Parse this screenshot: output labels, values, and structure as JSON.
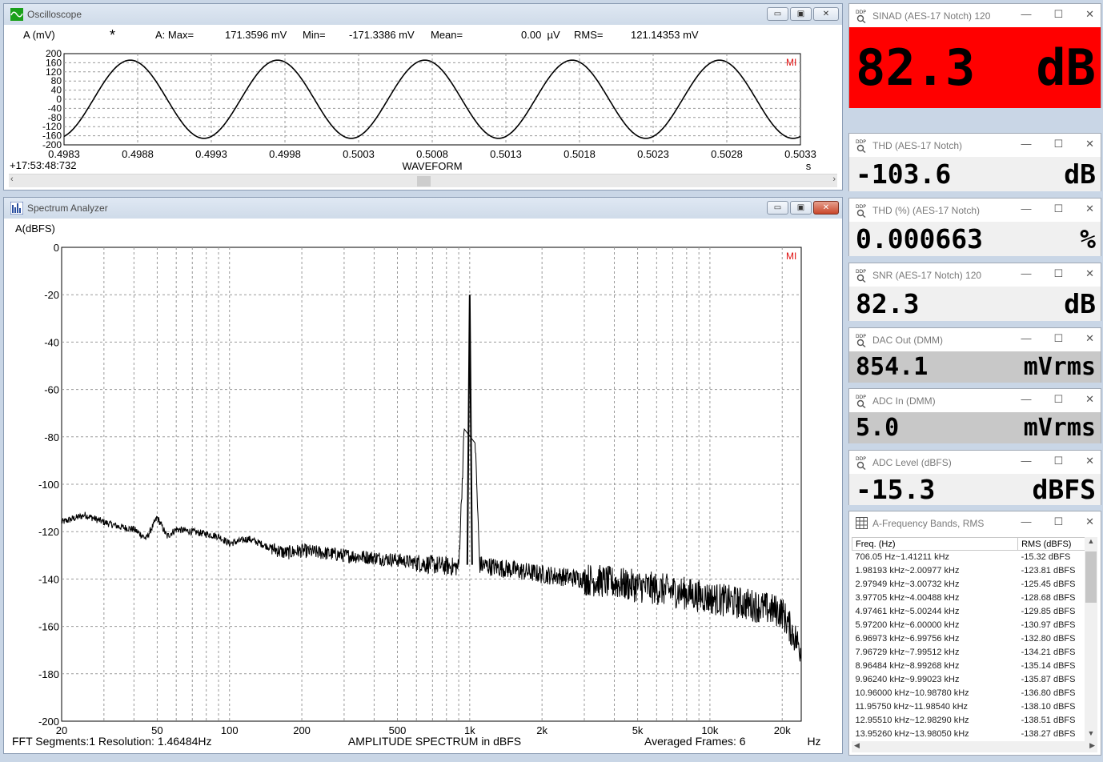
{
  "oscilloscope": {
    "title": "Oscilloscope",
    "channel_label": "A (mV)",
    "marker": "*",
    "stats": {
      "max_label": "A: Max=",
      "max_value": "171.3596 mV",
      "min_label": "Min=",
      "min_value": "-171.3386 mV",
      "mean_label": "Mean=",
      "mean_value": "0.00  µV",
      "rms_label": "RMS=",
      "rms_value": "121.14353 mV"
    },
    "timestamp": "+17:53:48:732",
    "x_title": "WAVEFORM",
    "x_unit": "s",
    "logo": "MI",
    "controls": {
      "minimize": "▭",
      "restore": "▣",
      "close": "✕"
    }
  },
  "spectrum": {
    "title": "Spectrum Analyzer",
    "y_title": "A(dBFS)",
    "x_title": "AMPLITUDE SPECTRUM in dBFS",
    "x_unit": "Hz",
    "footer_left": "FFT Segments:1   Resolution: 1.46484Hz",
    "footer_right": "Averaged Frames: 6",
    "logo": "MI",
    "controls": {
      "minimize": "▭",
      "restore": "▣",
      "close": "✕"
    }
  },
  "meters": [
    {
      "title": "SINAD (AES-17 Notch)  120",
      "value": "82.3 dB",
      "bg": "#ff0000"
    },
    {
      "title": "THD (AES-17 Notch)",
      "value": "-103.6 dB",
      "bg": "#f0f0f0"
    },
    {
      "title": "THD (%) (AES-17 Notch)",
      "value": "0.000663 %",
      "bg": "#f0f0f0"
    },
    {
      "title": "SNR (AES-17 Notch)  120",
      "value": "82.3 dB",
      "bg": "#f0f0f0"
    },
    {
      "title": "DAC Out (DMM)",
      "value": "854.1 mVrms",
      "bg": "#c8c8c8"
    },
    {
      "title": "ADC In (DMM)",
      "value": "5.0 mVrms",
      "bg": "#c8c8c8"
    },
    {
      "title": "ADC Level (dBFS)",
      "value": "-15.3 dBFS",
      "bg": "#f0f0f0"
    }
  ],
  "meter_controls": {
    "minimize": "—",
    "restore": "☐",
    "close": "✕"
  },
  "bands": {
    "title": "A-Frequency Bands, RMS",
    "columns": [
      "Freq. (Hz)",
      "RMS (dBFS)"
    ],
    "rows": [
      [
        "706.05 Hz~1.41211 kHz",
        "-15.32 dBFS"
      ],
      [
        "1.98193 kHz~2.00977 kHz",
        "-123.81 dBFS"
      ],
      [
        "2.97949 kHz~3.00732 kHz",
        "-125.45 dBFS"
      ],
      [
        "3.97705 kHz~4.00488 kHz",
        "-128.68 dBFS"
      ],
      [
        "4.97461 kHz~5.00244 kHz",
        "-129.85 dBFS"
      ],
      [
        "5.97200 kHz~6.00000 kHz",
        "-130.97 dBFS"
      ],
      [
        "6.96973 kHz~6.99756 kHz",
        "-132.80 dBFS"
      ],
      [
        "7.96729 kHz~7.99512 kHz",
        "-134.21 dBFS"
      ],
      [
        "8.96484 kHz~8.99268 kHz",
        "-135.14 dBFS"
      ],
      [
        "9.96240 kHz~9.99023 kHz",
        "-135.87 dBFS"
      ],
      [
        "10.96000 kHz~10.98780 kHz",
        "-136.80 dBFS"
      ],
      [
        "11.95750 kHz~11.98540 kHz",
        "-138.10 dBFS"
      ],
      [
        "12.95510 kHz~12.98290 kHz",
        "-138.51 dBFS"
      ],
      [
        "13.95260 kHz~13.98050 kHz",
        "-138.27 dBFS"
      ]
    ]
  },
  "chart_data": [
    {
      "type": "line",
      "title": "",
      "xlabel": "WAVEFORM",
      "ylabel": "A (mV)",
      "x_ticks": [
        "0.4983",
        "0.4988",
        "0.4993",
        "0.4998",
        "0.5003",
        "0.5008",
        "0.5013",
        "0.5018",
        "0.5023",
        "0.5028",
        "0.5033"
      ],
      "xlim": [
        0.4983,
        0.5033
      ],
      "y_ticks": [
        "200",
        "160",
        "120",
        "80",
        "40",
        "0",
        "-40",
        "-80",
        "-120",
        "-160",
        "-200"
      ],
      "ylim": [
        -200,
        200
      ],
      "series": [
        {
          "amplitude_mv": 171.36,
          "frequency_hz": 1000,
          "peak_time_s": 0.49875
        }
      ],
      "grid": true
    },
    {
      "type": "line",
      "title": "",
      "xlabel": "AMPLITUDE SPECTRUM in dBFS",
      "ylabel": "A(dBFS)",
      "x_scale": "log",
      "xlim": [
        20,
        24000
      ],
      "x_ticks": [
        "20",
        "50",
        "100",
        "200",
        "500",
        "1k",
        "2k",
        "5k",
        "10k",
        "20k"
      ],
      "x_tick_values": [
        20,
        50,
        100,
        200,
        500,
        1000,
        2000,
        5000,
        10000,
        20000
      ],
      "ylim": [
        -200,
        0
      ],
      "y_ticks": [
        "0",
        "-20",
        "-40",
        "-60",
        "-80",
        "-100",
        "-120",
        "-140",
        "-160",
        "-180",
        "-200"
      ],
      "series": [
        {
          "x": [
            20,
            25,
            30,
            35,
            40,
            45,
            50,
            55,
            60,
            70,
            80,
            90,
            100,
            120,
            150,
            170,
            200,
            300,
            400,
            500,
            700,
            900,
            1000,
            1100,
            1500,
            2000,
            3000,
            5000,
            7000,
            10000,
            15000,
            20000,
            24000
          ],
          "y": [
            -116,
            -113,
            -116,
            -118,
            -119,
            -123,
            -114,
            -122,
            -119,
            -120,
            -121,
            -122,
            -125,
            -123,
            -127,
            -129,
            -128,
            -130,
            -131,
            -132,
            -134,
            -135,
            -20,
            -134,
            -136,
            -138,
            -140,
            -143,
            -145,
            -148,
            -151,
            -154,
            -170
          ]
        }
      ],
      "grid": true
    }
  ]
}
